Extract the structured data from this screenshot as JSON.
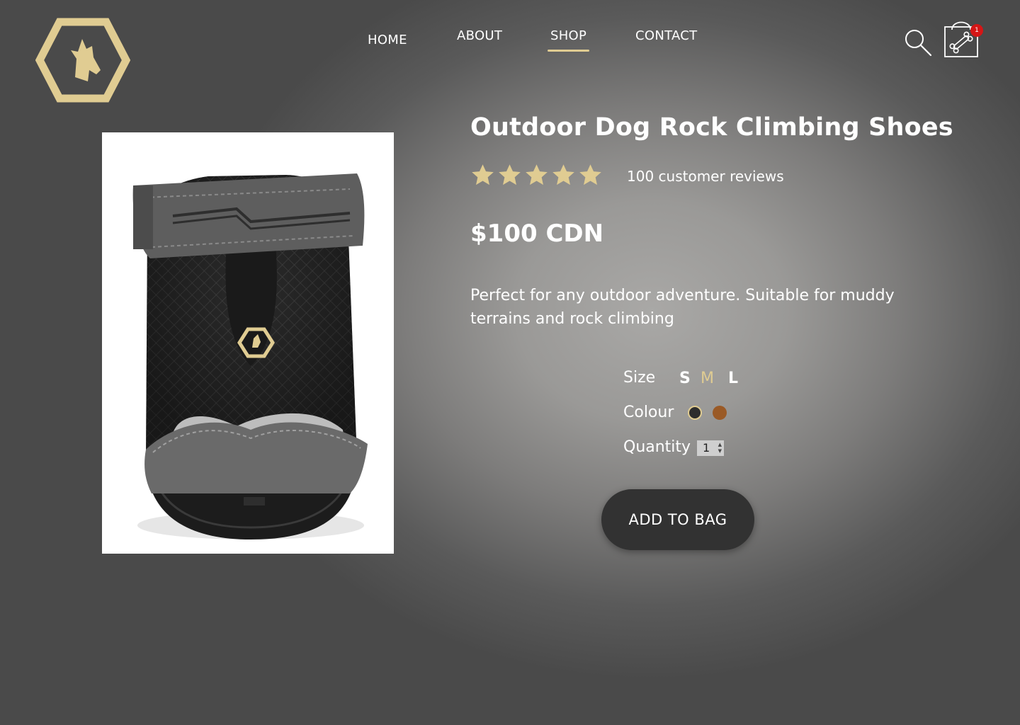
{
  "colors": {
    "accent": "#e0cc92",
    "button_bg": "#323232",
    "badge": "#d51616"
  },
  "header": {
    "logo_icon": "hexagon-dog-logo",
    "nav": [
      {
        "label": "HOME"
      },
      {
        "label": "ABOUT"
      },
      {
        "label": "SHOP",
        "active": true
      },
      {
        "label": "CONTACT"
      }
    ],
    "search_icon": "search-icon",
    "bag_icon": "shopping-bag-bone-icon",
    "bag_count": "1"
  },
  "product": {
    "title": "Outdoor Dog Rock Climbing Shoes",
    "rating": 5,
    "rating_max": 5,
    "reviews": "100 customer reviews",
    "price": "$100 CDN",
    "description": "Perfect for any outdoor adventure. Suitable for muddy terrains and rock climbing",
    "options": {
      "size_label": "Size",
      "sizes": [
        "S",
        "M",
        "L"
      ],
      "selected_size": "M",
      "colour_label": "Colour",
      "colours": [
        "#2d2d2d",
        "#9a5a26"
      ],
      "selected_colour": "#2d2d2d",
      "quantity_label": "Quantity",
      "quantity": "1"
    },
    "add_to_bag": "ADD TO BAG"
  }
}
